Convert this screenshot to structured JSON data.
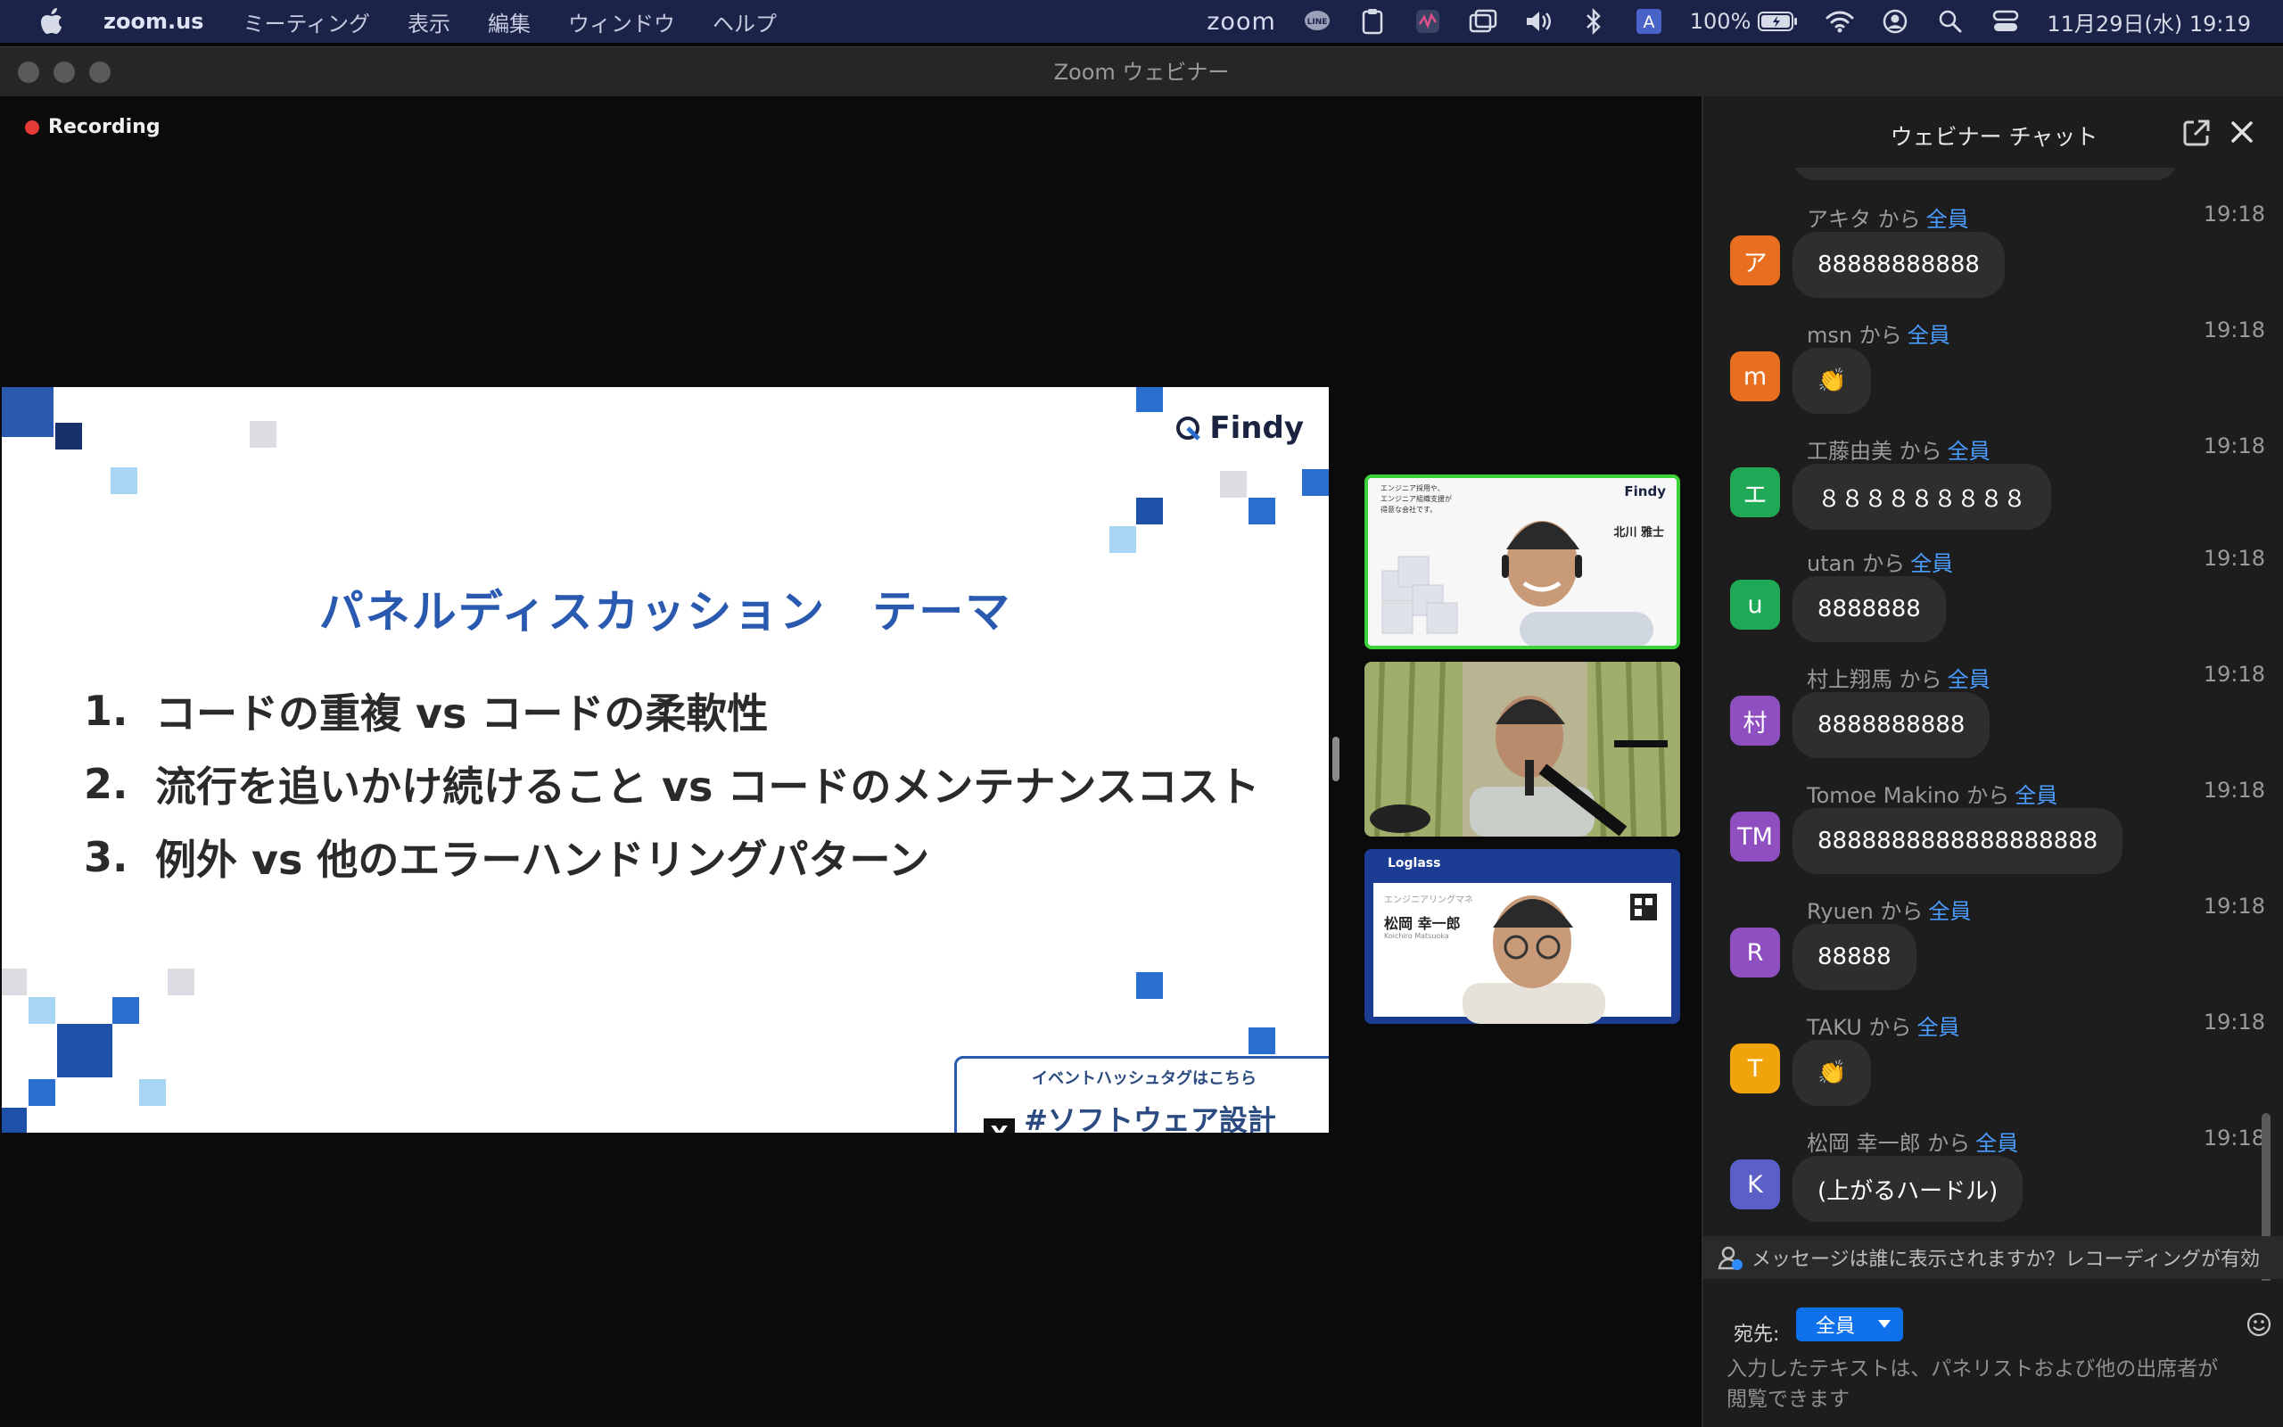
{
  "menubar": {
    "app_name": "zoom.us",
    "menus": [
      "ミーティング",
      "表示",
      "編集",
      "ウィンドウ",
      "ヘルプ"
    ],
    "zoom_status": "zoom",
    "battery": "100%",
    "clock": "11月29日(水)  19:19",
    "input_source": "A"
  },
  "window": {
    "title": "Zoom ウェビナー"
  },
  "recording": {
    "label": "Recording",
    "color": "#e53935"
  },
  "slide": {
    "logo_text": "Findy",
    "heading": "パネルディスカッション　テーマ",
    "topics": [
      {
        "num": "1.",
        "text": "コードの重複 vs コードの柔軟性"
      },
      {
        "num": "2.",
        "text": "流行を追いかけ続けること vs コードのメンテナンスコスト"
      },
      {
        "num": "3.",
        "text": "例外 vs 他のエラーハンドリングパターン"
      }
    ],
    "hashtag_caption": "イベントハッシュタグはこちら",
    "hashtag": "#ソフトウェア設計_findy",
    "x_logo": "X",
    "accent": "#2a5ab0"
  },
  "participants": [
    {
      "label": "Findy",
      "name_card": "北川 雅士",
      "active": true
    },
    {
      "label": "",
      "name_card": "",
      "active": false
    },
    {
      "label": "Loglass",
      "name_card": "松岡 幸一郎",
      "active": false
    }
  ],
  "chat": {
    "title": "ウェビナー チャット",
    "messages": [
      {
        "initial": "ア",
        "color": "#e86f1f",
        "sender": "アキタ",
        "from": "から",
        "to": "全員",
        "time": "19:18",
        "text": "88888888888"
      },
      {
        "initial": "m",
        "color": "#e86f1f",
        "sender": "msn",
        "from": "から",
        "to": "全員",
        "time": "19:18",
        "text": "👏"
      },
      {
        "initial": "エ",
        "color": "#1fa855",
        "sender": "工藤由美",
        "from": "から",
        "to": "全員",
        "time": "19:18",
        "text": "８８８８８８８８８"
      },
      {
        "initial": "u",
        "color": "#1fa855",
        "sender": "utan",
        "from": "から",
        "to": "全員",
        "time": "19:18",
        "text": "8888888"
      },
      {
        "initial": "村",
        "color": "#8f4fc0",
        "sender": "村上翔馬",
        "from": "から",
        "to": "全員",
        "time": "19:18",
        "text": "8888888888"
      },
      {
        "initial": "TM",
        "color": "#8f4fc0",
        "sender": "Tomoe Makino",
        "from": "から",
        "to": "全員",
        "time": "19:18",
        "text": "8888888888888888888"
      },
      {
        "initial": "R",
        "color": "#8f4fc0",
        "sender": "Ryuen",
        "from": "から",
        "to": "全員",
        "time": "19:18",
        "text": "88888"
      },
      {
        "initial": "T",
        "color": "#f0a30a",
        "sender": "TAKU",
        "from": "から",
        "to": "全員",
        "time": "19:18",
        "text": "👏"
      },
      {
        "initial": "K",
        "color": "#5b5fc7",
        "sender": "松岡 幸一郎",
        "from": "から",
        "to": "全員",
        "time": "19:18",
        "text": "(上がるハードル)"
      }
    ],
    "notice": "メッセージは誰に表示されますか？レコーディングが有効",
    "to_label": "宛先:",
    "to_value": "全員",
    "placeholder": "入力したテキストは、パネリストおよび他の出席者が閲覧できます"
  }
}
